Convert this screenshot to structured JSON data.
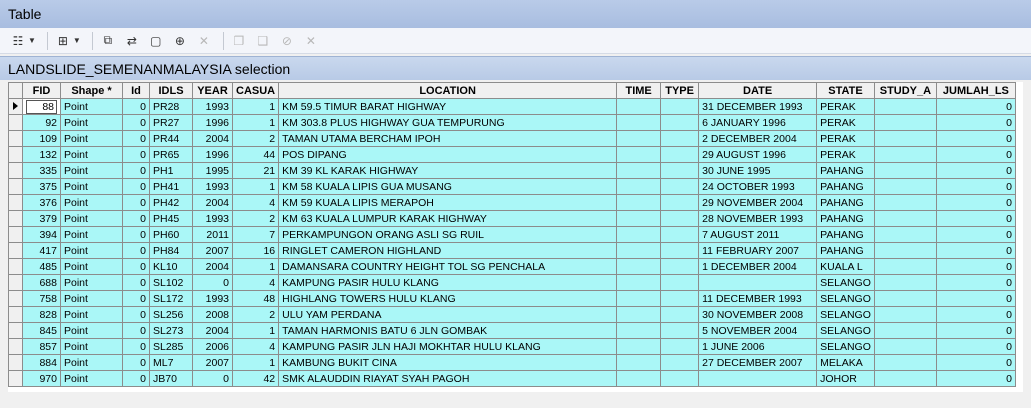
{
  "window": {
    "title": "Table"
  },
  "toolbar": {
    "buttons": [
      {
        "name": "table-options-icon",
        "glyph": "☷"
      },
      {
        "name": "related-tables-icon",
        "glyph": "⊞"
      },
      {
        "name": "select-by-attributes-icon",
        "glyph": "⧉"
      },
      {
        "name": "switch-selection-icon",
        "glyph": "⇄"
      },
      {
        "name": "clear-selection-icon",
        "glyph": "▢"
      },
      {
        "name": "zoom-to-selected-icon",
        "glyph": "⊕"
      },
      {
        "name": "delete-selected-icon",
        "glyph": "✕"
      },
      {
        "name": "copy-icon",
        "glyph": "❐"
      },
      {
        "name": "paste-icon",
        "glyph": "❑"
      },
      {
        "name": "zoom-icon",
        "glyph": "⊘"
      },
      {
        "name": "delete-icon",
        "glyph": "✕"
      }
    ]
  },
  "table": {
    "name": "LANDSLIDE_SEMENANMALAYSIA selection",
    "columns": [
      "FID",
      "Shape *",
      "Id",
      "IDLS",
      "YEAR",
      "CASUA",
      "LOCATION",
      "TIME",
      "TYPE",
      "DATE",
      "STATE",
      "STUDY_A",
      "JUMLAH_LS"
    ],
    "rows": [
      [
        "88",
        "Point",
        "0",
        "PR28",
        "1993",
        "1",
        "KM 59.5 TIMUR BARAT HIGHWAY",
        "",
        "",
        "31 DECEMBER 1993",
        "PERAK",
        "",
        "0"
      ],
      [
        "92",
        "Point",
        "0",
        "PR27",
        "1996",
        "1",
        "KM 303.8 PLUS HIGHWAY GUA TEMPURUNG",
        "",
        "",
        "6 JANUARY 1996",
        "PERAK",
        "",
        "0"
      ],
      [
        "109",
        "Point",
        "0",
        "PR44",
        "2004",
        "2",
        "TAMAN UTAMA BERCHAM IPOH",
        "",
        "",
        "2 DECEMBER 2004",
        "PERAK",
        "",
        "0"
      ],
      [
        "132",
        "Point",
        "0",
        "PR65",
        "1996",
        "44",
        "POS DIPANG",
        "",
        "",
        "29 AUGUST 1996",
        "PERAK",
        "",
        "0"
      ],
      [
        "335",
        "Point",
        "0",
        "PH1",
        "1995",
        "21",
        "KM 39 KL KARAK HIGHWAY",
        "",
        "",
        "30 JUNE 1995",
        "PAHANG",
        "",
        "0"
      ],
      [
        "375",
        "Point",
        "0",
        "PH41",
        "1993",
        "1",
        "KM 58 KUALA LIPIS GUA MUSANG",
        "",
        "",
        "24 OCTOBER 1993",
        "PAHANG",
        "",
        "0"
      ],
      [
        "376",
        "Point",
        "0",
        "PH42",
        "2004",
        "4",
        "KM 59 KUALA LIPIS MERAPOH",
        "",
        "",
        "29 NOVEMBER 2004",
        "PAHANG",
        "",
        "0"
      ],
      [
        "379",
        "Point",
        "0",
        "PH45",
        "1993",
        "2",
        "KM 63 KUALA LUMPUR KARAK HIGHWAY",
        "",
        "",
        "28 NOVEMBER 1993",
        "PAHANG",
        "",
        "0"
      ],
      [
        "394",
        "Point",
        "0",
        "PH60",
        "2011",
        "7",
        "PERKAMPUNGON ORANG ASLI SG RUIL",
        "",
        "",
        "7 AUGUST 2011",
        "PAHANG",
        "",
        "0"
      ],
      [
        "417",
        "Point",
        "0",
        "PH84",
        "2007",
        "16",
        "RINGLET CAMERON HIGHLAND",
        "",
        "",
        "11 FEBRUARY 2007",
        "PAHANG",
        "",
        "0"
      ],
      [
        "485",
        "Point",
        "0",
        "KL10",
        "2004",
        "1",
        "DAMANSARA COUNTRY HEIGHT TOL SG PENCHALA",
        "",
        "",
        "1 DECEMBER 2004",
        "KUALA L",
        "",
        "0"
      ],
      [
        "688",
        "Point",
        "0",
        "SL102",
        "0",
        "4",
        "KAMPUNG PASIR HULU KLANG",
        "",
        "",
        "",
        "SELANGO",
        "",
        "0"
      ],
      [
        "758",
        "Point",
        "0",
        "SL172",
        "1993",
        "48",
        "HIGHLANG TOWERS HULU KLANG",
        "",
        "",
        "11 DECEMBER 1993",
        "SELANGO",
        "",
        "0"
      ],
      [
        "828",
        "Point",
        "0",
        "SL256",
        "2008",
        "2",
        "ULU YAM PERDANA",
        "",
        "",
        "30 NOVEMBER 2008",
        "SELANGO",
        "",
        "0"
      ],
      [
        "845",
        "Point",
        "0",
        "SL273",
        "2004",
        "1",
        "TAMAN HARMONIS BATU 6 JLN GOMBAK",
        "",
        "",
        "5 NOVEMBER 2004",
        "SELANGO",
        "",
        "0"
      ],
      [
        "857",
        "Point",
        "0",
        "SL285",
        "2006",
        "4",
        "KAMPUNG PASIR JLN HAJI MOKHTAR HULU KLANG",
        "",
        "",
        "1 JUNE 2006",
        "SELANGO",
        "",
        "0"
      ],
      [
        "884",
        "Point",
        "0",
        "ML7",
        "2007",
        "1",
        "KAMBUNG BUKIT CINA",
        "",
        "",
        "27 DECEMBER 2007",
        "MELAKA",
        "",
        "0"
      ],
      [
        "970",
        "Point",
        "0",
        "JB70",
        "0",
        "42",
        "SMK ALAUDDIN RIAYAT SYAH PAGOH",
        "",
        "",
        "",
        "JOHOR",
        "",
        "0"
      ]
    ]
  }
}
